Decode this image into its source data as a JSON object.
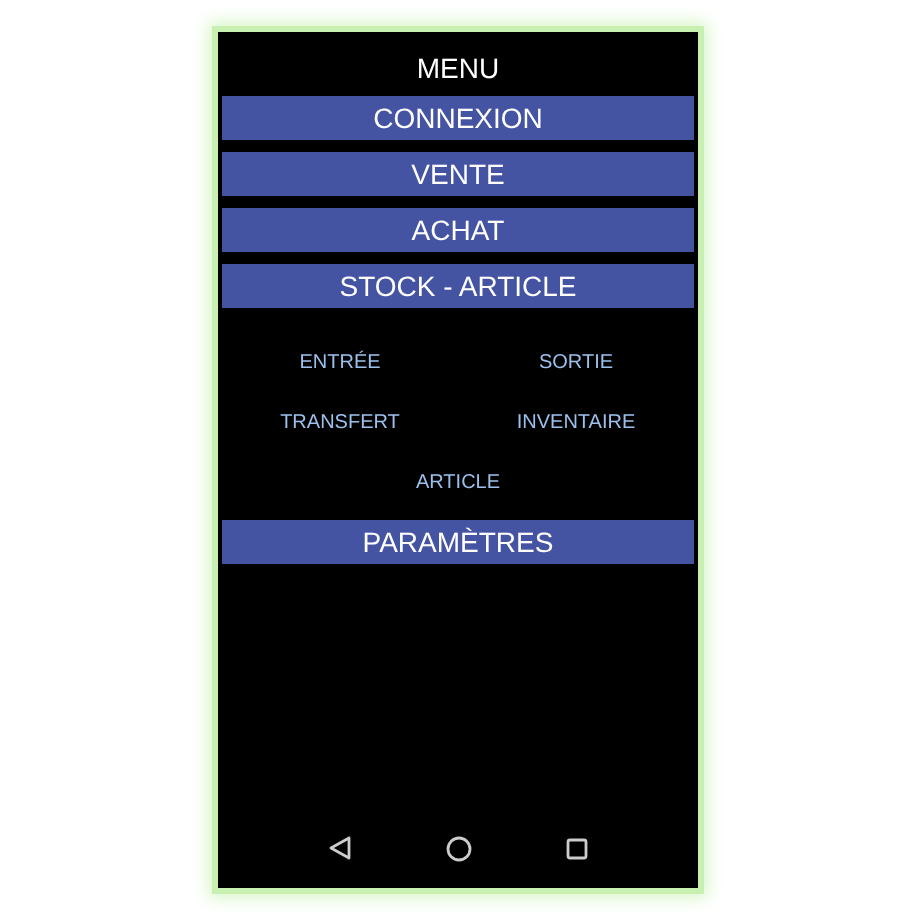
{
  "title": "MENU",
  "menu": [
    {
      "kind": "button",
      "label": "CONNEXION"
    },
    {
      "kind": "button",
      "label": "VENTE"
    },
    {
      "kind": "button",
      "label": "ACHAT"
    },
    {
      "kind": "button",
      "label": "STOCK - ARTICLE"
    },
    {
      "kind": "submenu",
      "items": [
        "ENTRÉE",
        "SORTIE",
        "TRANSFERT",
        "INVENTAIRE",
        "ARTICLE"
      ]
    },
    {
      "kind": "button",
      "label": "PARAMÈTRES"
    }
  ]
}
